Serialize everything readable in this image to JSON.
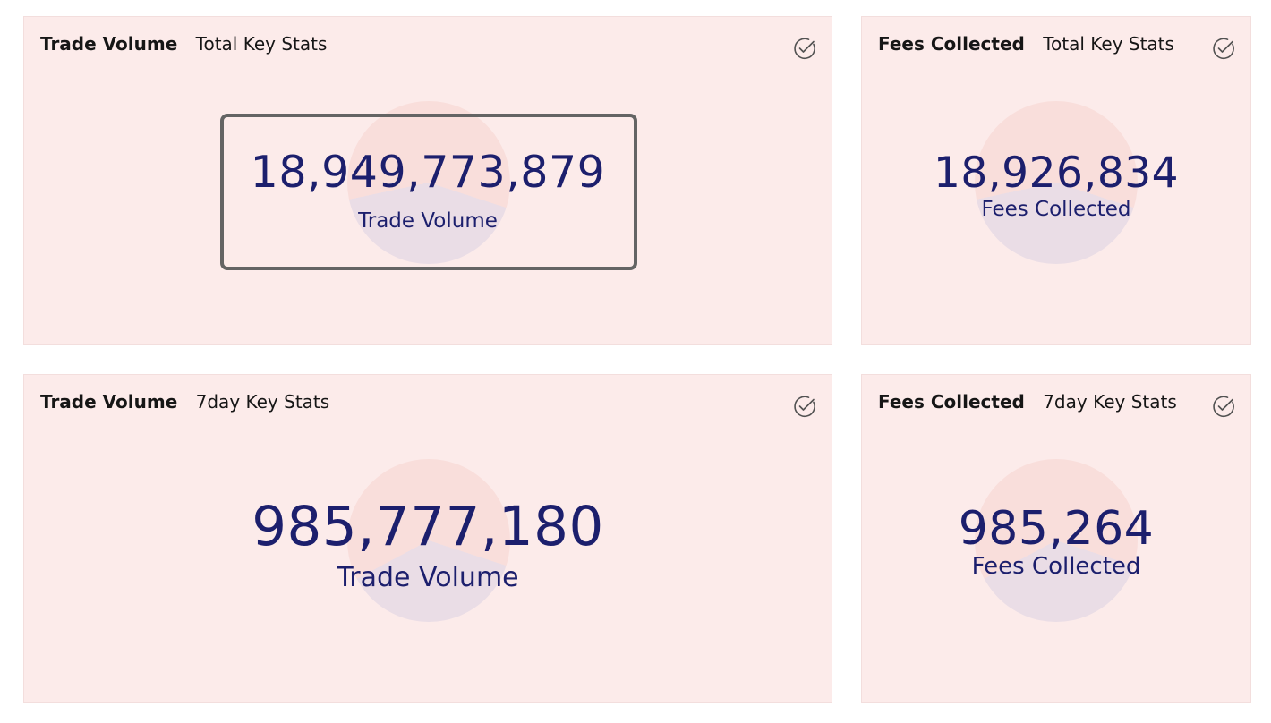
{
  "cards": [
    {
      "title": "Trade Volume",
      "subtitle": "Total Key Stats",
      "value": "18,949,773,879",
      "label": "Trade Volume",
      "icon": "check-circle-icon"
    },
    {
      "title": "Fees Collected",
      "subtitle": "Total Key Stats",
      "value": "18,926,834",
      "label": "Fees Collected",
      "icon": "check-circle-icon"
    },
    {
      "title": "Trade Volume",
      "subtitle": "7day Key Stats",
      "value": "985,777,180",
      "label": "Trade Volume",
      "icon": "check-circle-icon"
    },
    {
      "title": "Fees Collected",
      "subtitle": "7day Key Stats",
      "value": "985,264",
      "label": "Fees Collected",
      "icon": "check-circle-icon"
    }
  ],
  "colors": {
    "card_background": "#fcebea",
    "value_text": "#1c1f6d",
    "pie_segment_a": "#f9dedb",
    "pie_segment_b": "#eadde6",
    "focus_outline": "#646464"
  }
}
